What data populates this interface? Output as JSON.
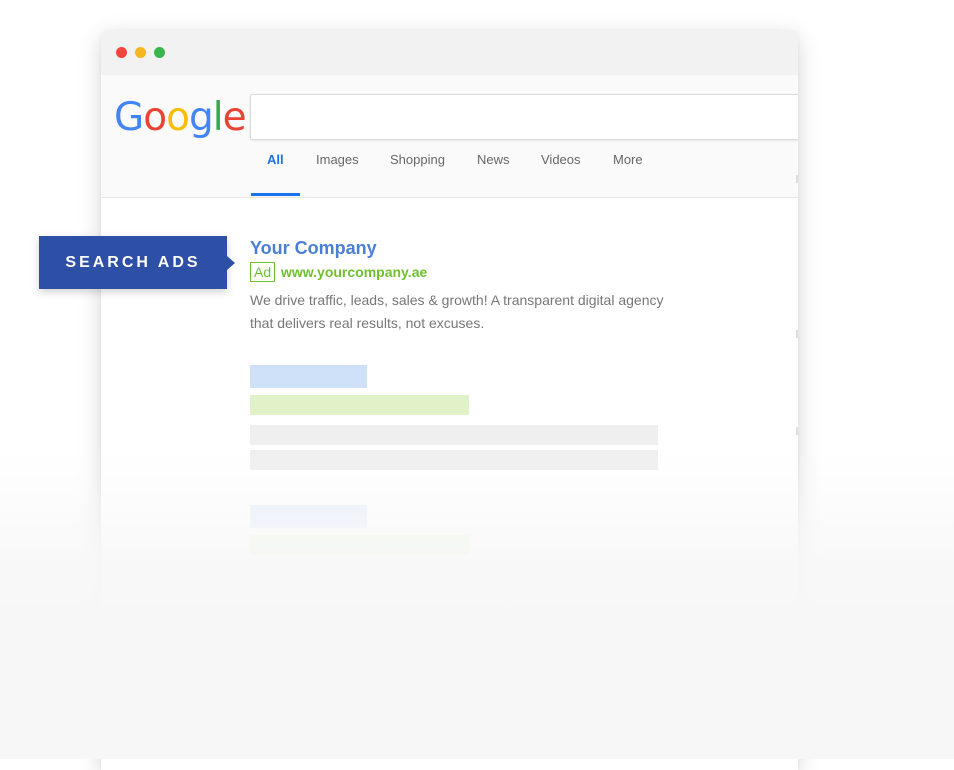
{
  "browser": {
    "window_dots": [
      "red",
      "yellow",
      "green"
    ]
  },
  "google": {
    "logo_letters": [
      {
        "char": "G",
        "color": "#4285F4"
      },
      {
        "char": "o",
        "color": "#EA4335"
      },
      {
        "char": "o",
        "color": "#FBBC05"
      },
      {
        "char": "g",
        "color": "#4285F4"
      },
      {
        "char": "l",
        "color": "#34A853"
      },
      {
        "char": "e",
        "color": "#EA4335"
      }
    ],
    "search_value": "",
    "tabs": [
      {
        "label": "All",
        "active": true
      },
      {
        "label": "Images",
        "active": false
      },
      {
        "label": "Shopping",
        "active": false
      },
      {
        "label": "News",
        "active": false
      },
      {
        "label": "Videos",
        "active": false
      },
      {
        "label": "More",
        "active": false
      }
    ]
  },
  "ad": {
    "title": "Your Company",
    "badge": "Ad",
    "url": "www.yourcompany.ae",
    "description": "We drive traffic, leads, sales & growth! A transparent digital agency that delivers real results, not excuses."
  },
  "callout": {
    "label": "SEARCH ADS"
  },
  "colors": {
    "accent_blue": "#1a73e8",
    "ad_title": "#4a7fd6",
    "ad_green": "#6fc02f",
    "callout_bg": "#2e4fa6"
  }
}
